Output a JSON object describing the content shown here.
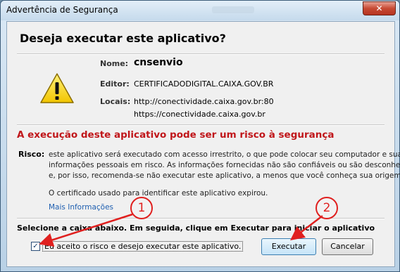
{
  "window": {
    "title": "Advertência de Segurança",
    "close_glyph": "✕"
  },
  "dialog": {
    "heading": "Deseja executar este aplicativo?",
    "icon": "warning-icon",
    "fields": {
      "name_label": "Nome:",
      "name_value": "cnsenvio",
      "editor_label": "Editor:",
      "editor_value": "CERTIFICADODIGITAL.CAIXA.GOV.BR",
      "locais_label": "Locais:",
      "locais_value_1": "http://conectividade.caixa.gov.br:80",
      "locais_value_2": "https://conectividade.caixa.gov.br"
    },
    "risk_title": "A execução deste aplicativo pode ser um risco à segurança",
    "risk_label": "Risco:",
    "risk_lines": [
      "este aplicativo será executado com acesso irrestrito, o que pode colocar seu computador e suas",
      "informações pessoais em risco. As informações fornecidas não são confiáveis ou são desconhecidas",
      "e, por isso, recomenda-se não executar este aplicativo, a menos que você conheça sua origem"
    ],
    "cert_text": "O certificado usado para identificar este aplicativo expirou.",
    "more_info_link": "Mais Informações",
    "instruction": "Selecione a caixa abaixo. Em seguida, clique em Executar para iniciar o aplicativo",
    "accept_checkbox": {
      "checked": true,
      "check_glyph": "✓",
      "label": "Eu aceito o risco e desejo executar este aplicativo."
    },
    "buttons": {
      "run": "Executar",
      "cancel": "Cancelar"
    }
  },
  "annotations": {
    "marker_1": "1",
    "marker_2": "2",
    "color": "#e0201f"
  }
}
